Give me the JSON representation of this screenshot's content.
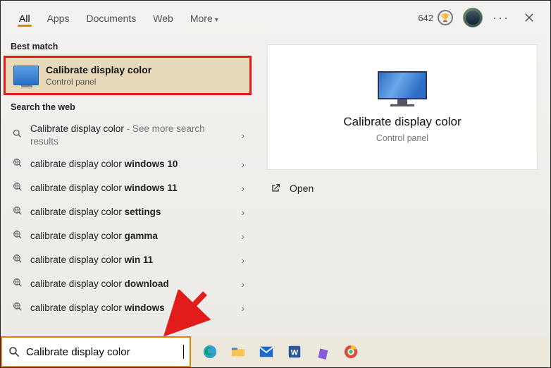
{
  "header": {
    "tabs": {
      "all": "All",
      "apps": "Apps",
      "documents": "Documents",
      "web": "Web",
      "more": "More"
    },
    "points": "642"
  },
  "left": {
    "best_match_label": "Best match",
    "best_match": {
      "title": "Calibrate display color",
      "subtitle": "Control panel"
    },
    "search_web_label": "Search the web",
    "items": [
      {
        "prefix": "Calibrate display color",
        "suffix": "",
        "sub": " - See more search results",
        "icon": "search"
      },
      {
        "prefix": "calibrate display color ",
        "suffix": "windows 10",
        "sub": "",
        "icon": "web"
      },
      {
        "prefix": "calibrate display color ",
        "suffix": "windows 11",
        "sub": "",
        "icon": "web"
      },
      {
        "prefix": "calibrate display color ",
        "suffix": "settings",
        "sub": "",
        "icon": "web"
      },
      {
        "prefix": "calibrate display color ",
        "suffix": "gamma",
        "sub": "",
        "icon": "web"
      },
      {
        "prefix": "calibrate display color ",
        "suffix": "win 11",
        "sub": "",
        "icon": "web"
      },
      {
        "prefix": "calibrate display color ",
        "suffix": "download",
        "sub": "",
        "icon": "web"
      },
      {
        "prefix": "calibrate display color ",
        "suffix": "windows",
        "sub": "",
        "icon": "web"
      }
    ]
  },
  "right": {
    "title": "Calibrate display color",
    "subtitle": "Control panel",
    "open": "Open"
  },
  "search": {
    "value": "Calibrate display color"
  },
  "taskbar_icons": [
    "edge",
    "file-explorer",
    "mail",
    "word",
    "notes",
    "chrome"
  ]
}
